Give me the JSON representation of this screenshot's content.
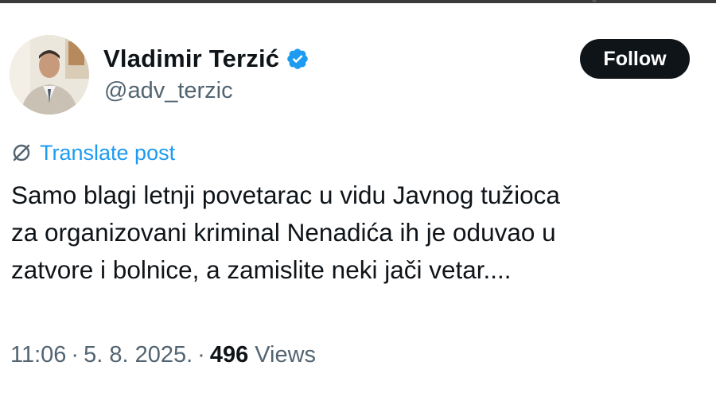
{
  "author": {
    "display_name": "Vladimir Terzić",
    "handle": "@adv_terzic",
    "avatar_icon": "profile-photo",
    "verified_icon": "verified-badge-icon",
    "verified_color": "#1d9bf0"
  },
  "follow_label": "Follow",
  "translate": {
    "icon": "globe-icon",
    "label": "Translate post",
    "color": "#1d9bf0"
  },
  "post": {
    "lines": [
      "Samo blagi letnji povetarac u vidu Javnog tužioca",
      "za organizovani kriminal Nenadića ih je oduvao u",
      "zatvore i bolnice, a zamislite neki jači vetar...."
    ]
  },
  "meta": {
    "time": "11:06",
    "separator": "·",
    "date": "5. 8. 2025.",
    "views_count": "496",
    "views_label": "Views"
  },
  "colors": {
    "text": "#0f1419",
    "secondary_text": "#536471",
    "button_bg": "#0f1419",
    "background": "#ffffff"
  }
}
